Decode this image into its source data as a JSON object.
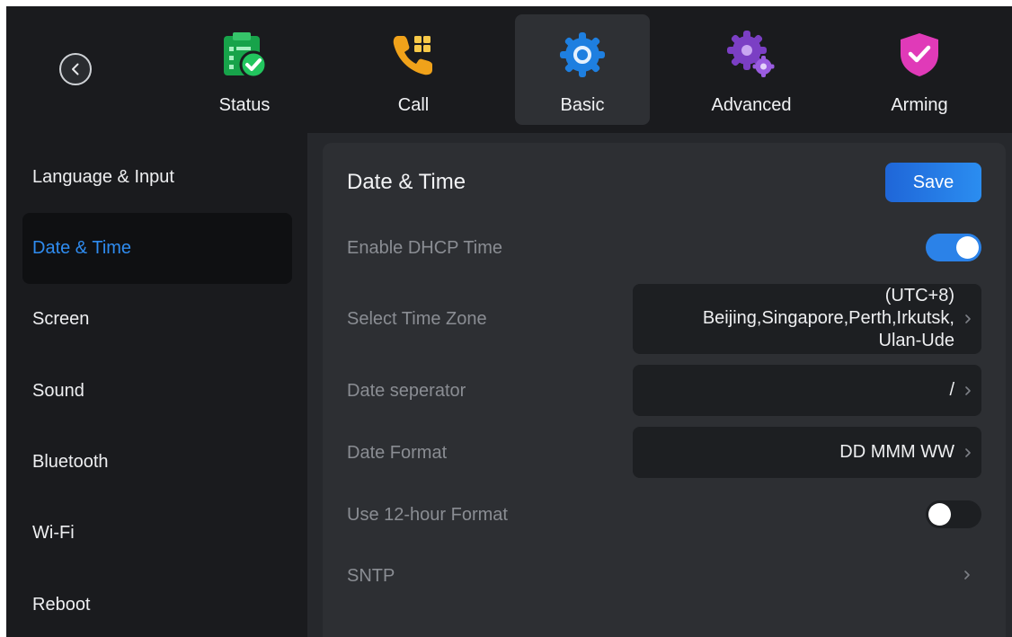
{
  "nav": {
    "tabs": [
      {
        "label": "Status",
        "icon": "status-icon"
      },
      {
        "label": "Call",
        "icon": "call-icon"
      },
      {
        "label": "Basic",
        "icon": "basic-gear-icon"
      },
      {
        "label": "Advanced",
        "icon": "advanced-gear-icon"
      },
      {
        "label": "Arming",
        "icon": "arming-shield-icon"
      }
    ],
    "active_tab": "Basic"
  },
  "sidebar": {
    "items": [
      {
        "label": "Language & Input"
      },
      {
        "label": "Date & Time"
      },
      {
        "label": "Screen"
      },
      {
        "label": "Sound"
      },
      {
        "label": "Bluetooth"
      },
      {
        "label": "Wi-Fi"
      },
      {
        "label": "Reboot"
      }
    ],
    "active_item": "Date & Time"
  },
  "panel": {
    "title": "Date & Time",
    "save_label": "Save",
    "dhcp": {
      "label": "Enable DHCP Time",
      "enabled": true
    },
    "timezone": {
      "label": "Select Time Zone",
      "value_lines": [
        "(UTC+8)",
        "Beijing,Singapore,Perth,Irkutsk,",
        "Ulan-Ude"
      ]
    },
    "separator": {
      "label": "Date seperator",
      "value": "/"
    },
    "format": {
      "label": "Date Format",
      "value": "DD MMM WW"
    },
    "hour12": {
      "label": "Use 12-hour Format",
      "enabled": false
    },
    "sntp": {
      "label": "SNTP"
    }
  },
  "colors": {
    "accent": "#2b82e8",
    "active_text": "#2f8cf0",
    "background": "#1a1b1e",
    "panel": "#2d2f33"
  }
}
